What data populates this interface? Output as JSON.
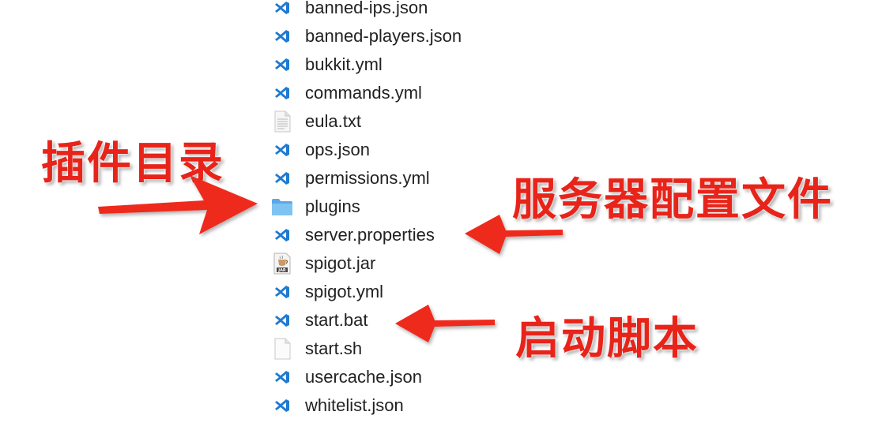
{
  "files": [
    {
      "name": "banned-ips.json",
      "icon": "vscode-icon"
    },
    {
      "name": "banned-players.json",
      "icon": "vscode-icon"
    },
    {
      "name": "bukkit.yml",
      "icon": "vscode-icon"
    },
    {
      "name": "commands.yml",
      "icon": "vscode-icon"
    },
    {
      "name": "eula.txt",
      "icon": "text-document-icon"
    },
    {
      "name": "ops.json",
      "icon": "vscode-icon"
    },
    {
      "name": "permissions.yml",
      "icon": "vscode-icon"
    },
    {
      "name": "plugins",
      "icon": "folder-icon"
    },
    {
      "name": "server.properties",
      "icon": "vscode-icon"
    },
    {
      "name": "spigot.jar",
      "icon": "jar-icon"
    },
    {
      "name": "spigot.yml",
      "icon": "vscode-icon"
    },
    {
      "name": "start.bat",
      "icon": "vscode-icon"
    },
    {
      "name": "start.sh",
      "icon": "blank-document-icon"
    },
    {
      "name": "usercache.json",
      "icon": "vscode-icon"
    },
    {
      "name": "whitelist.json",
      "icon": "vscode-icon"
    }
  ],
  "annotations": {
    "plugins_dir": "插件目录",
    "server_config": "服务器配置文件",
    "start_script": "启动脚本"
  },
  "colors": {
    "annotation_red": "#e8241a",
    "vscode_blue": "#1f7ad1",
    "folder_blue": "#6cb8ee",
    "jar_label": "JAR"
  }
}
